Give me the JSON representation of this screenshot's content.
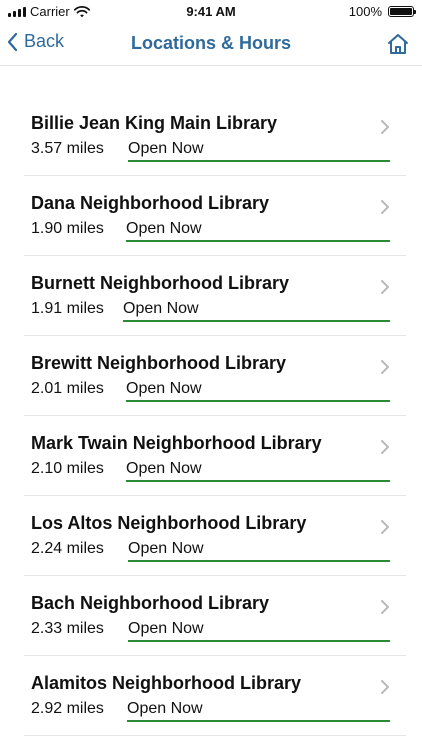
{
  "status_bar": {
    "carrier": "Carrier",
    "time": "9:41 AM",
    "battery": "100%"
  },
  "nav": {
    "back_label": "Back",
    "title": "Locations & Hours"
  },
  "colors": {
    "accent": "#2f6a9b",
    "open_underline": "#2c8a32"
  },
  "locations": [
    {
      "name": "Billie Jean King Main Library",
      "distance": "3.57 miles",
      "status": "Open Now"
    },
    {
      "name": "Dana Neighborhood Library",
      "distance": "1.90 miles",
      "status": "Open Now"
    },
    {
      "name": "Burnett Neighborhood Library",
      "distance": "1.91 miles",
      "status": "Open Now"
    },
    {
      "name": "Brewitt Neighborhood Library",
      "distance": "2.01 miles",
      "status": "Open Now"
    },
    {
      "name": "Mark Twain Neighborhood Library",
      "distance": "2.10 miles",
      "status": "Open Now"
    },
    {
      "name": "Los Altos Neighborhood Library",
      "distance": "2.24 miles",
      "status": "Open Now"
    },
    {
      "name": "Bach Neighborhood Library",
      "distance": "2.33 miles",
      "status": "Open Now"
    },
    {
      "name": "Alamitos Neighborhood Library",
      "distance": "2.92 miles",
      "status": "Open Now"
    }
  ]
}
